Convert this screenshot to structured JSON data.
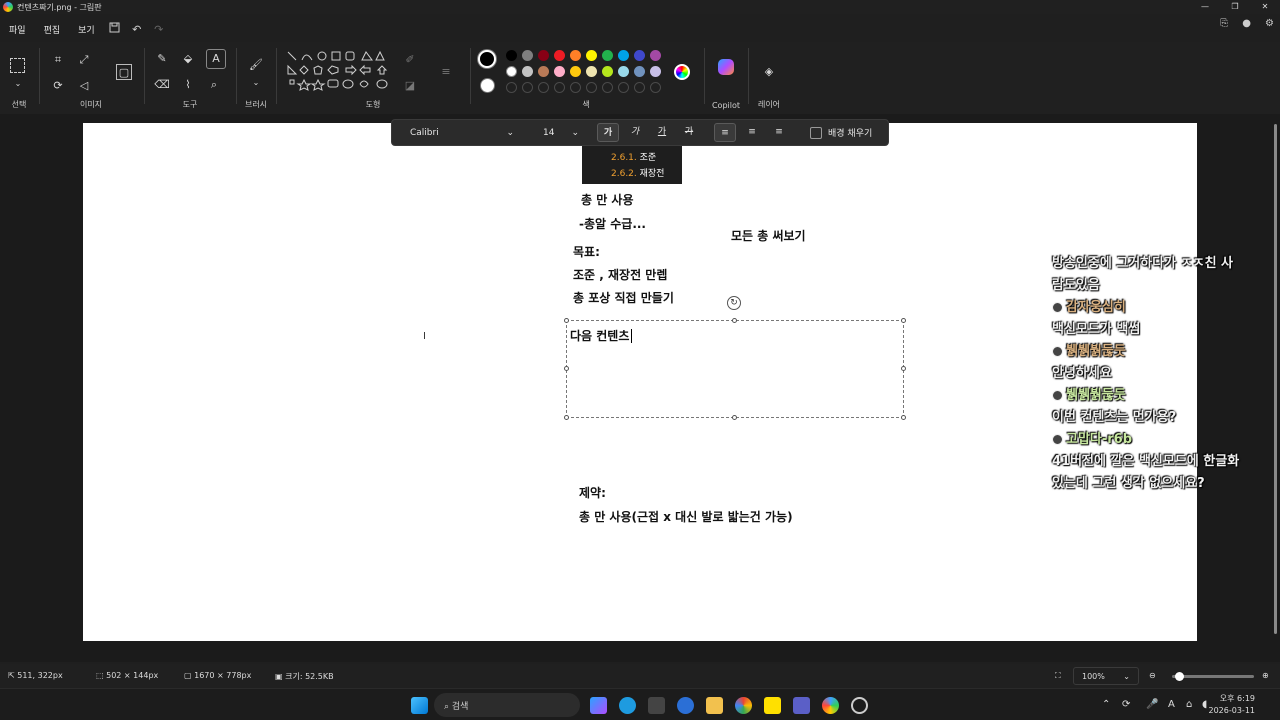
{
  "window": {
    "title": "컨텐츠짜기.png - 그림판",
    "minimize": "—",
    "maximize": "❐",
    "close": "✕"
  },
  "menu": {
    "items": [
      "파일",
      "편집",
      "보기"
    ],
    "save_icon": "save-icon",
    "undo_icon": "undo-icon",
    "redo_icon": "redo-icon",
    "right_icons": [
      "share-icon",
      "account-icon",
      "settings-icon"
    ]
  },
  "ribbon": {
    "groups": {
      "select": "선택",
      "image": "이미지",
      "tools": "도구",
      "brushes": "브러시",
      "shapes": "도형",
      "colors": "색",
      "copilot": "Copilot",
      "layers": "레이어"
    },
    "palette_row1": [
      "#000000",
      "#7f7f7f",
      "#880015",
      "#ed1c24",
      "#ff7f27",
      "#fff200",
      "#22b14c",
      "#00a2e8",
      "#3f48cc",
      "#a349a4"
    ],
    "palette_row2": [
      "#ffffff",
      "#c3c3c3",
      "#b97a57",
      "#ffaec9",
      "#ffc90e",
      "#efe4b0",
      "#b5e61d",
      "#99d9ea",
      "#7092be",
      "#c8bfe7"
    ],
    "primary_color": "#000000",
    "secondary_color": "#ffffff"
  },
  "text_toolbar": {
    "font": "Calibri",
    "size": "14",
    "bold": "가",
    "italic": "가",
    "underline": "가",
    "strike": "가",
    "fill_background": "배경 채우기"
  },
  "canvas": {
    "outline": [
      {
        "num": "2.6.1.",
        "text": " 조준"
      },
      {
        "num": "2.6.2.",
        "text": " 재장전"
      }
    ],
    "lines": {
      "gun_only": "총 만 사용",
      "ammo": "-총알 수급...",
      "all_guns": "모든 총 써보기",
      "goal_label": "목표:",
      "goal_1": "조준 , 재장전 만렙",
      "goal_2": "총 포상 직접 만들기",
      "editing": "다음 컨텐츠",
      "limit_label": "제약:",
      "limit_1": "총 만 사용(근접 x 대신 발로 밟는건 가능)"
    }
  },
  "chat": {
    "lines": [
      {
        "type": "msg",
        "text": "방송인중에 그거하다가 ㅈㅈ친 사"
      },
      {
        "type": "msg",
        "text": "람도있음"
      },
      {
        "type": "user",
        "text": "감자웅심히",
        "brown": true
      },
      {
        "type": "msg",
        "text": "백신모드가 백썸"
      },
      {
        "type": "user",
        "text": "뷁뷁붥둖둣",
        "brown": true
      },
      {
        "type": "msg",
        "text": "안녕하세요"
      },
      {
        "type": "user",
        "text": "뷁뷁붥둖둣",
        "brown": false
      },
      {
        "type": "msg",
        "text": "이번 컨텐츠는 먼가용?"
      },
      {
        "type": "user",
        "text": "고맙다-r6b",
        "brown": false
      },
      {
        "type": "msg",
        "text": "41버전에 깔은 백신모드에 한글화"
      },
      {
        "type": "msg",
        "text": "있는데 그런 생각 없으세요?"
      }
    ]
  },
  "status": {
    "cursor": "511, 322px",
    "selection": "502 × 144px",
    "canvas_size": "1670 × 778px",
    "file_size": "크기: 52.5KB",
    "zoom": "100%"
  },
  "taskbar": {
    "search_placeholder": "검색",
    "time": "오후 6:19",
    "date": "2026-03-11",
    "ime": "A"
  }
}
